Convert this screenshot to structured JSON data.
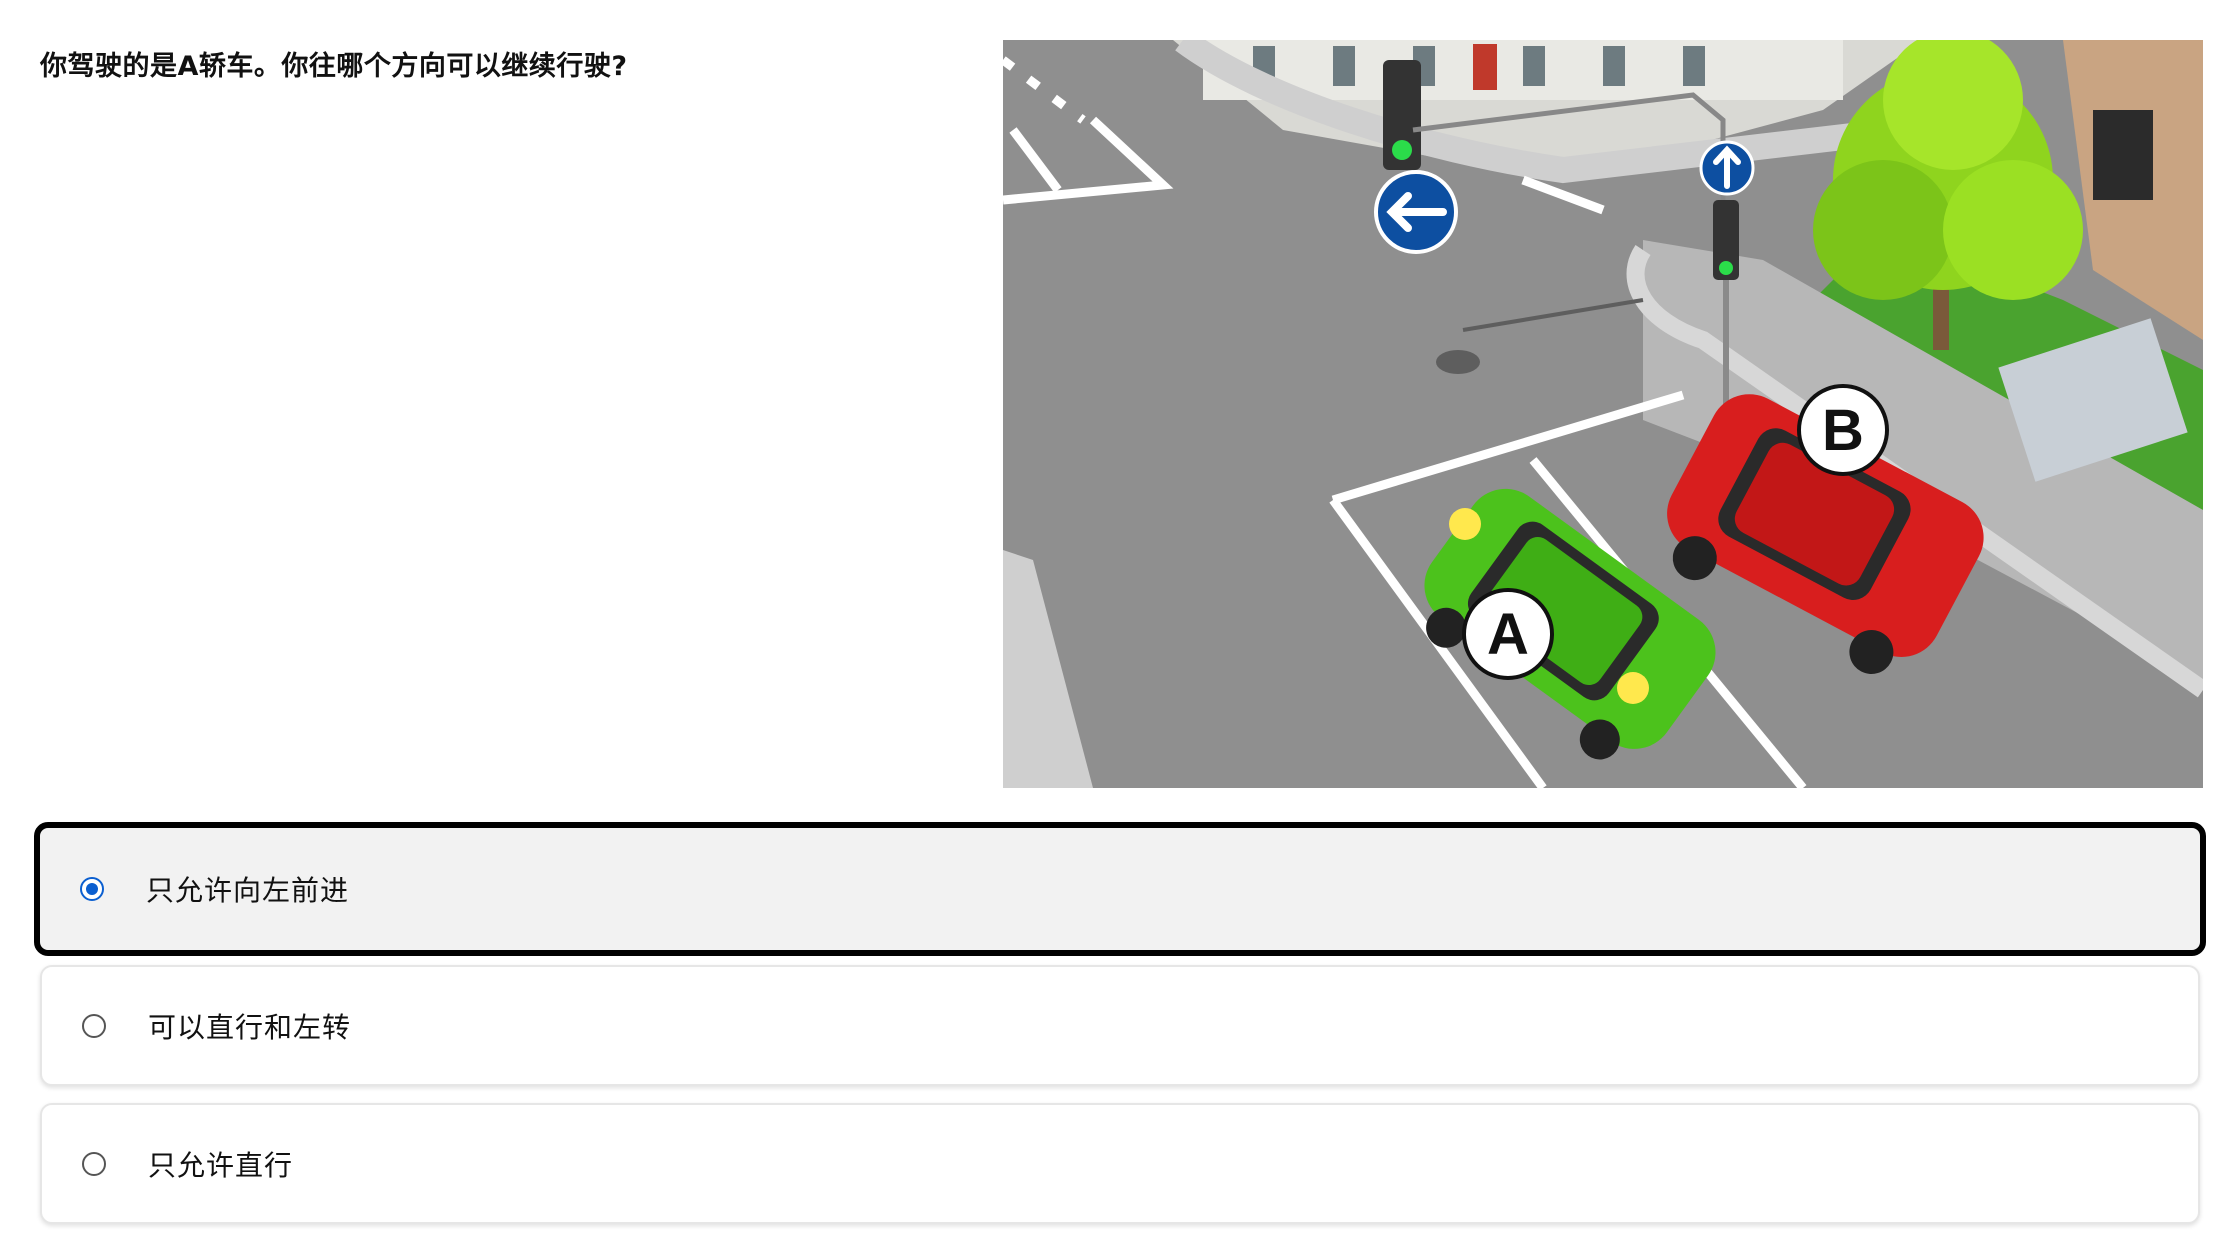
{
  "question": {
    "text": "你驾驶的是A轿车。你往哪个方向可以继续行驶?"
  },
  "scene": {
    "marker_a": "A",
    "marker_b": "B",
    "colors": {
      "car_a": "#4cc21c",
      "car_b": "#d81e1e",
      "sign_blue": "#0d4fa1",
      "road": "#8e8e8e",
      "grass": "#3f9a2a"
    },
    "icons": [
      "left-arrow-sign",
      "straight-arrow-sign",
      "traffic-light",
      "tree",
      "building"
    ]
  },
  "options": [
    {
      "label": "只允许向左前进",
      "selected": true
    },
    {
      "label": "可以直行和左转",
      "selected": false
    },
    {
      "label": "只允许直行",
      "selected": false
    }
  ],
  "colors": {
    "selected_border": "#000000",
    "selected_bg": "#f2f2f2",
    "radio_accent": "#0b5fd0"
  }
}
